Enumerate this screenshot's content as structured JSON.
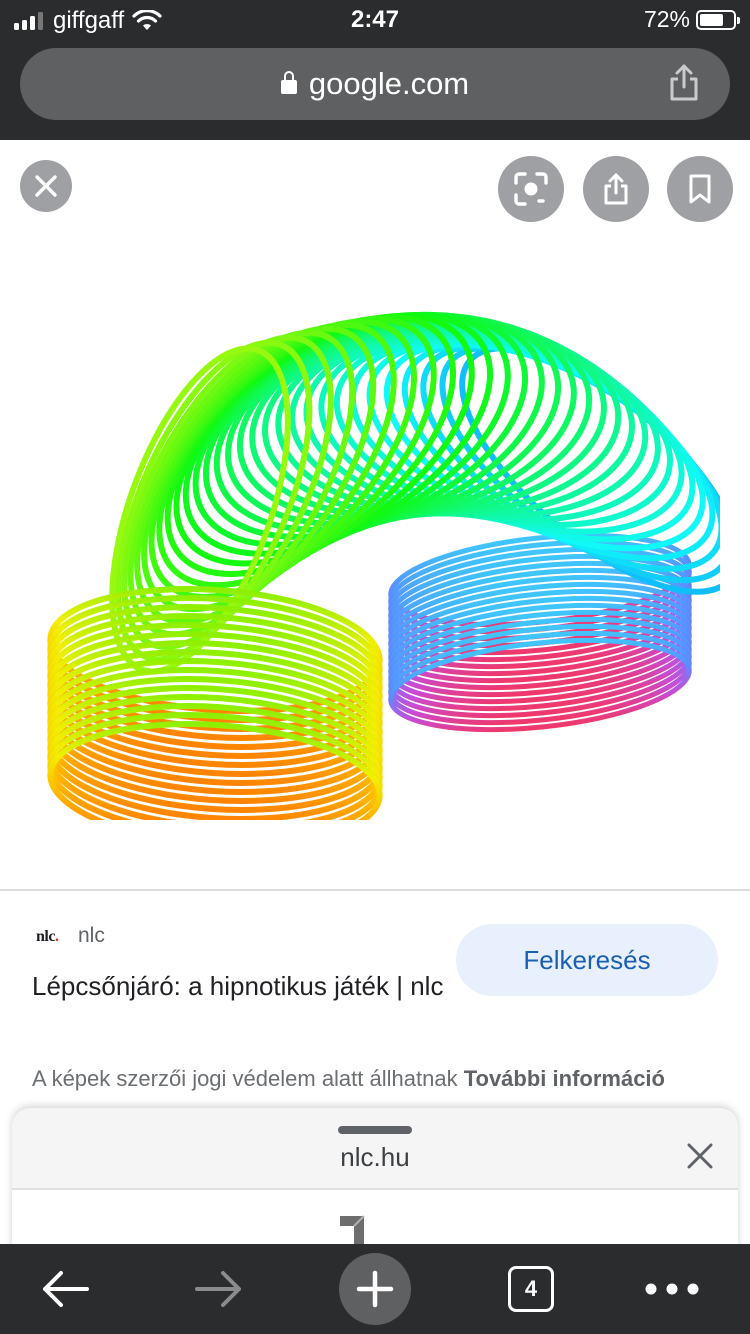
{
  "status_bar": {
    "carrier": "giffgaff",
    "time": "2:47",
    "battery_percent": "72%",
    "battery_level": 0.72,
    "signal_bars": 4,
    "signal_bars_active": 3
  },
  "url_bar": {
    "domain": "google.com",
    "lock_icon": "lock-icon",
    "share_icon": "share-icon"
  },
  "image_viewer": {
    "controls": [
      "close-icon",
      "lens-icon",
      "share-icon",
      "bookmark-icon"
    ],
    "image_subject": "rainbow-slinky"
  },
  "result": {
    "source_logo_text": "nlc",
    "source_logo_dot": ".",
    "source_name": "nlc",
    "title": "Lépcsőnjáró: a hipnotikus játék | nlc",
    "visit_label": "Felkeresés",
    "copyright_text": "A képek szerzői jogi védelem alatt állhatnak",
    "more_info_label": "További információ"
  },
  "bottom_sheet": {
    "domain": "nlc.hu",
    "close_icon": "close-icon"
  },
  "toolbar": {
    "tab_count": "4",
    "icons": [
      "back-arrow-icon",
      "forward-arrow-icon",
      "plus-icon",
      "tabs-icon",
      "more-icon"
    ]
  },
  "colors": {
    "chrome_dark": "#2b2c2e",
    "url_pill": "#5e6062",
    "visit_button_bg": "#e8f0fe",
    "visit_button_text": "#1a5fb4",
    "logo_dot": "#d93025"
  }
}
